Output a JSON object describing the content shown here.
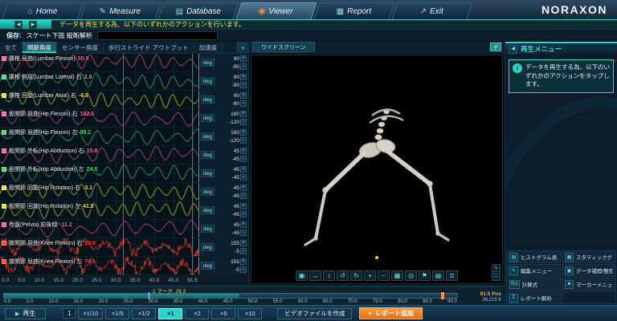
{
  "icons": {
    "plus": "+",
    "minus": "−",
    "play": "▶",
    "step_back": "◀",
    "step_forward": "▶",
    "info": "i",
    "add": "+",
    "collapse": "◀"
  },
  "nav": {
    "brand": "NORAXON",
    "tabs": [
      {
        "label": "Home",
        "icon": "home-icon",
        "glyph": "⌂",
        "active": false
      },
      {
        "label": "Measure",
        "icon": "measure-icon",
        "glyph": "✎",
        "active": false
      },
      {
        "label": "Database",
        "icon": "database-icon",
        "glyph": "▤",
        "active": false
      },
      {
        "label": "Viewer",
        "icon": "viewer-icon",
        "glyph": "◉",
        "active": true
      },
      {
        "label": "Report",
        "icon": "report-icon",
        "glyph": "▦",
        "active": false
      },
      {
        "label": "Exit",
        "icon": "exit-icon",
        "glyph": "↗",
        "active": false
      }
    ]
  },
  "notice": {
    "message": "データを再生する為、以下のいずれかのアクションを行います。"
  },
  "save_bar": {
    "label": "保存:",
    "value": "スケート下肢 縦断解析"
  },
  "channel_tabs": [
    {
      "label": "全て",
      "active": false
    },
    {
      "label": "関節角度",
      "active": true
    },
    {
      "label": "センサー角度",
      "active": false
    },
    {
      "label": "歩行ストライド アウトプット",
      "active": false
    },
    {
      "label": "加速度",
      "active": false
    }
  ],
  "channels": [
    {
      "name": "腰椎 屈曲(Lumbar Flexion)",
      "value": "50.9",
      "color": "#ff5fa2",
      "unit": "deg",
      "max": "90",
      "min": "-90",
      "seed": 3,
      "spiky": false
    },
    {
      "name": "腰椎 側屈(Lumbar Lateral) 右",
      "value": "2.8",
      "color": "#43d97c",
      "unit": "deg",
      "max": "90",
      "min": "-90",
      "seed": 7,
      "spiky": false
    },
    {
      "name": "腰椎 回旋(Lumbar Axial) 右",
      "value": "-6.8",
      "color": "#e8e337",
      "unit": "deg",
      "max": "90",
      "min": "-90",
      "seed": 11,
      "spiky": false
    },
    {
      "name": "股関節 屈曲(Hip Flexion) 右",
      "value": "102.6",
      "color": "#ff5fa2",
      "unit": "deg",
      "max": "180",
      "min": "-120",
      "seed": 15,
      "spiky": false
    },
    {
      "name": "股関節 屈曲(Hip Flexion) 左",
      "value": "89.2",
      "color": "#43d97c",
      "unit": "deg",
      "max": "180",
      "min": "-120",
      "seed": 19,
      "spiky": false
    },
    {
      "name": "股関節 外転(Hip Abduction) 右",
      "value": "15.8",
      "color": "#ff5fa2",
      "unit": "deg",
      "max": "45",
      "min": "-45",
      "seed": 23,
      "spiky": false
    },
    {
      "name": "股関節 外転(Hip Abduction) 左",
      "value": "24.5",
      "color": "#43d97c",
      "unit": "deg",
      "max": "45",
      "min": "-45",
      "seed": 27,
      "spiky": false
    },
    {
      "name": "股関節 回旋(Hip Rotation) 右",
      "value": "-3.1",
      "color": "#e8e337",
      "unit": "deg",
      "max": "45",
      "min": "-45",
      "seed": 31,
      "spiky": false
    },
    {
      "name": "股関節 回旋(Hip Rotation) 左",
      "value": "41.8",
      "color": "#e8e337",
      "unit": "deg",
      "max": "45",
      "min": "-45",
      "seed": 35,
      "spiky": false
    },
    {
      "name": "骨盤(Pelvis) 前後傾",
      "value": "-11.2",
      "color": "#ff5fa2",
      "unit": "deg",
      "max": "45",
      "min": "-45",
      "seed": 39,
      "spiky": false
    },
    {
      "name": "膝関節 屈曲(Knee Flexion) 右",
      "value": "25.6",
      "color": "#ff4433",
      "unit": "deg",
      "max": "155",
      "min": "-5",
      "seed": 43,
      "spiky": true
    },
    {
      "name": "膝関節 屈曲(Knee Flexion) 左",
      "value": "79.6",
      "color": "#ff4433",
      "unit": "deg",
      "max": "155",
      "min": "-5",
      "seed": 47,
      "spiky": true
    }
  ],
  "axis_ticks": [
    "0.0",
    "5.0",
    "10.0",
    "15.0",
    "20.0",
    "25.0",
    "30.0",
    "35.0",
    "40.0",
    "45.0",
    "91.5"
  ],
  "viewer3d": {
    "tab": "ワイドスクリーン",
    "side_button": "テ",
    "toolbar": [
      {
        "glyph": "▣",
        "name": "fit-view-icon"
      },
      {
        "glyph": "↔",
        "name": "pan-horizontal-icon"
      },
      {
        "glyph": "↕",
        "name": "pan-vertical-icon"
      },
      {
        "glyph": "↺",
        "name": "rotate-left-icon"
      },
      {
        "glyph": "↻",
        "name": "rotate-right-icon"
      },
      {
        "glyph": "+",
        "name": "zoom-in-icon"
      },
      {
        "glyph": "−",
        "name": "zoom-out-icon"
      },
      {
        "glyph": "▦",
        "name": "grid-icon"
      },
      {
        "glyph": "◎",
        "name": "center-target-icon"
      },
      {
        "glyph": "⚑",
        "name": "marker-flag-icon"
      },
      {
        "glyph": "▤",
        "name": "layers-icon"
      },
      {
        "glyph": "≣",
        "name": "view-menu-icon"
      }
    ],
    "corner": [
      {
        "glyph": "+",
        "name": "corner-zoom-in-icon"
      },
      {
        "glyph": "−",
        "name": "corner-zoom-out-icon"
      }
    ]
  },
  "sidebar": {
    "title": "再生メニュー",
    "info": "データを再生する為、以下のいずれかのアクションをタップします。",
    "menu": [
      {
        "glyph": "▤",
        "icon": "histogram-icon",
        "label": "ヒストグラム表示"
      },
      {
        "glyph": "▦",
        "icon": "static-graph-icon",
        "label": "スタティックグラフ"
      },
      {
        "glyph": "✎",
        "icon": "edit-menu-icon",
        "label": "編集メニュー"
      },
      {
        "glyph": "▣",
        "icon": "data-interpolation-icon",
        "label": "データ補間/整形"
      },
      {
        "glyph": "f(x)",
        "icon": "formula-icon",
        "label": "計算式"
      },
      {
        "glyph": "⚑",
        "icon": "marker-menu-icon",
        "label": "マーカーメニュー"
      },
      {
        "glyph": "Σ",
        "icon": "report-analysis-icon",
        "label": "レポート解析"
      }
    ]
  },
  "timeline": {
    "marker_label": "1 マーク: 29.2",
    "ticks": [
      "0.0",
      "5.0",
      "10.0",
      "15.0",
      "20.0",
      "25.0",
      "30.0",
      "35.0",
      "40.0",
      "45.0",
      "50.0",
      "55.0",
      "60.0",
      "65.0",
      "70.0",
      "75.0",
      "80.0",
      "85.0",
      "90.0"
    ],
    "position": "91.5 Pos",
    "frames": "28,215 fr"
  },
  "transport": {
    "play": "再生",
    "counter": "1",
    "speeds": [
      "×1/10",
      "×1/5",
      "×1/2",
      "×1",
      "×2",
      "×5",
      "×10"
    ],
    "active_speed": "×1",
    "video_button": "ビデオファイルを作成",
    "report_button": "レポート追加"
  }
}
